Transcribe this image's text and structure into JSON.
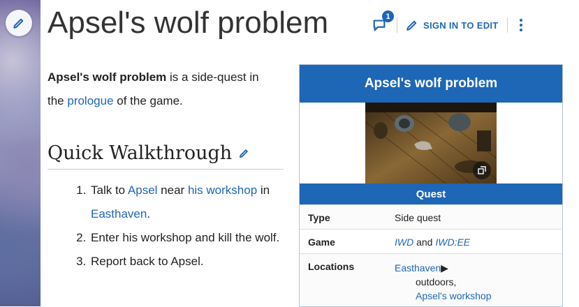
{
  "page": {
    "title": "Apsel's wolf problem",
    "comment_count": "1",
    "sign_in_label": "SIGN IN TO EDIT"
  },
  "intro": {
    "bold": "Apsel's wolf problem",
    "text1": " is a side-quest in the ",
    "link": "prologue",
    "text2": " of the game."
  },
  "section": {
    "heading": "Quick Walkthrough"
  },
  "steps": {
    "s1_pre": "Talk to ",
    "s1_link1": "Apsel",
    "s1_mid": " near ",
    "s1_link2": "his workshop",
    "s1_in": " in ",
    "s1_link3": "Easthaven",
    "s1_end": ".",
    "s2": "Enter his workshop and kill the wolf.",
    "s3": "Report back to Apsel."
  },
  "infobox": {
    "title": "Apsel's wolf problem",
    "section": "Quest",
    "type_label": "Type",
    "type_value": "Side quest",
    "game_label": "Game",
    "game_v1": "IWD",
    "game_and": " and ",
    "game_v2": "IWD:EE",
    "loc_label": "Locations",
    "loc_v1": "Easthaven",
    "loc_arrow": "▶",
    "loc_v2": "outdoors,",
    "loc_v3": "Apsel's workshop"
  },
  "colors": {
    "accent": "#1e66b6"
  },
  "icons": [
    "pencil-icon",
    "comment-icon",
    "more-vertical-icon",
    "expand-icon"
  ]
}
